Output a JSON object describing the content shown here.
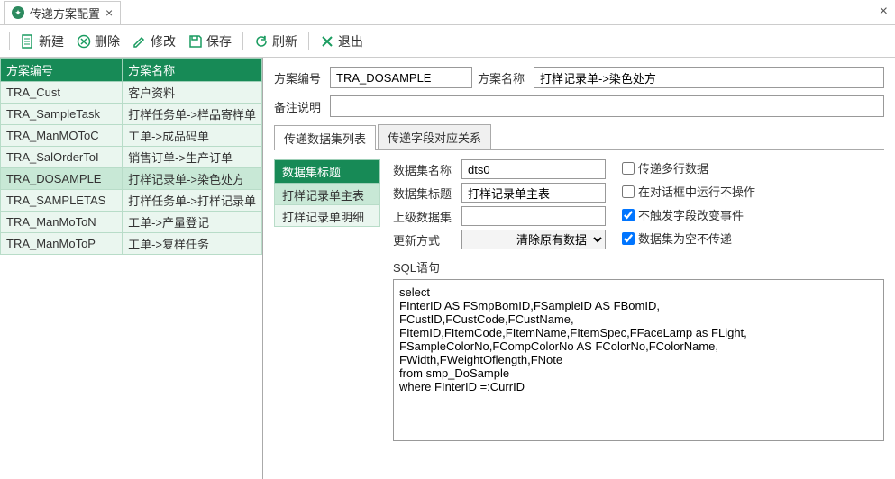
{
  "tab": {
    "title": "传递方案配置",
    "close": "×",
    "winClose": "×"
  },
  "toolbar": {
    "new": "新建",
    "delete": "删除",
    "edit": "修改",
    "save": "保存",
    "refresh": "刷新",
    "exit": "退出"
  },
  "leftTable": {
    "col1": "方案编号",
    "col2": "方案名称",
    "rows": [
      {
        "code": "TRA_Cust",
        "name": "客户资料"
      },
      {
        "code": "TRA_SampleTask",
        "name": "打样任务单->样品寄样单"
      },
      {
        "code": "TRA_ManMOToC",
        "name": "工单->成品码单"
      },
      {
        "code": "TRA_SalOrderToI",
        "name": "销售订单->生产订单"
      },
      {
        "code": "TRA_DOSAMPLE",
        "name": "打样记录单->染色处方"
      },
      {
        "code": "TRA_SAMPLETAS",
        "name": "打样任务单->打样记录单"
      },
      {
        "code": "TRA_ManMoToN",
        "name": "工单->产量登记"
      },
      {
        "code": "TRA_ManMoToP",
        "name": "工单->复样任务"
      }
    ],
    "selectedIndex": 4
  },
  "form": {
    "codeLabel": "方案编号",
    "codeValue": "TRA_DOSAMPLE",
    "nameLabel": "方案名称",
    "nameValue": "打样记录单->染色处方",
    "remarkLabel": "备注说明",
    "remarkValue": ""
  },
  "subtabs": {
    "t1": "传递数据集列表",
    "t2": "传递字段对应关系"
  },
  "dsList": {
    "header": "数据集标题",
    "items": [
      "打样记录单主表",
      "打样记录单明细"
    ],
    "selectedIndex": 0
  },
  "dsForm": {
    "dsNameLbl": "数据集名称",
    "dsNameVal": "dts0",
    "dsTitleLbl": "数据集标题",
    "dsTitleVal": "打样记录单主表",
    "parentLbl": "上级数据集",
    "parentVal": "",
    "updateLbl": "更新方式",
    "updateVal": "清除原有数据",
    "chk1": "传递多行数据",
    "chk2": "在对话框中运行不操作",
    "chk3": "不触发字段改变事件",
    "chk4": "数据集为空不传递",
    "sqlLbl": "SQL语句",
    "sqlVal": "select\nFInterID AS FSmpBomID,FSampleID AS FBomID,\nFCustID,FCustCode,FCustName,\nFItemID,FItemCode,FItemName,FItemSpec,FFaceLamp as FLight,\nFSampleColorNo,FCompColorNo AS FColorNo,FColorName,\nFWidth,FWeightOflength,FNote\nfrom smp_DoSample\nwhere FInterID =:CurrID"
  }
}
